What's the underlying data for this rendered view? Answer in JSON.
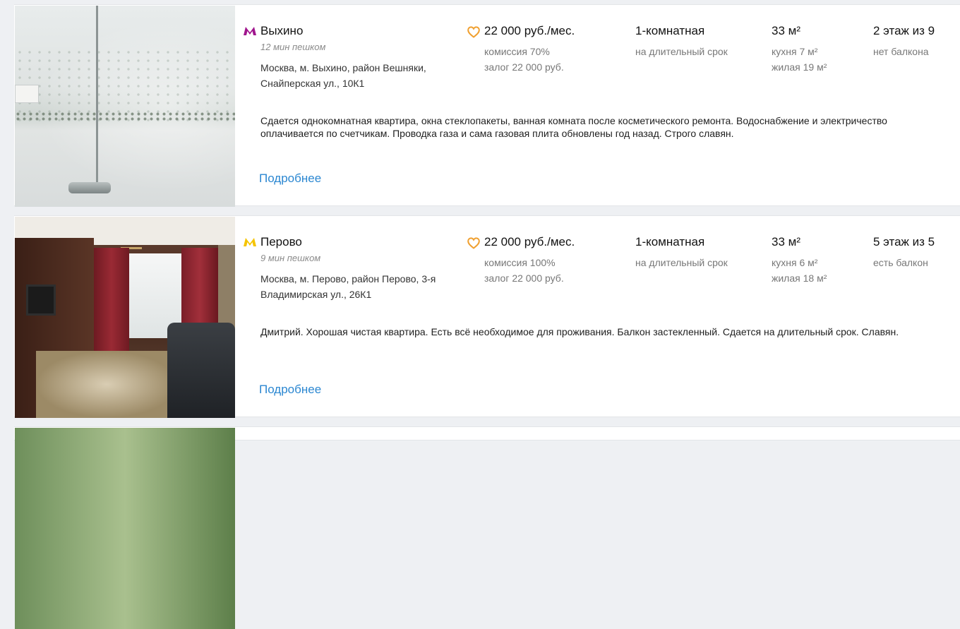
{
  "listings": [
    {
      "metro_color": "#a0158d",
      "station": "Выхино",
      "walk": "12 мин пешком",
      "address": "Москва, м. Выхино, район Вешняки, Снайперская ул., 10К1",
      "price": "22 000 руб./мес.",
      "commission": "комиссия 70%",
      "deposit": "залог 22 000 руб.",
      "rooms": "1-комнатная",
      "term": "на длительный срок",
      "area": "33 м²",
      "kitchen": "кухня 7 м²",
      "living": "жилая 19 м²",
      "floor": "2 этаж из 9",
      "balcony": "нет балкона",
      "description": "Сдается однокомнатная квартира, окна стеклопакеты, ванная комната после косметического ремонта. Водоснабжение и электричество оплачивается по счетчикам. Проводка газа и сама газовая плита обновлены год назад. Строго славян.",
      "more_label": "Подробнее"
    },
    {
      "metro_color": "#f5c400",
      "station": "Перово",
      "walk": "9 мин пешком",
      "address": "Москва, м. Перово, район Перово, 3-я Владимирская ул., 26К1",
      "price": "22 000 руб./мес.",
      "commission": "комиссия 100%",
      "deposit": "залог 22 000 руб.",
      "rooms": "1-комнатная",
      "term": "на длительный срок",
      "area": "33 м²",
      "kitchen": "кухня 6 м²",
      "living": "жилая 18 м²",
      "floor": "5 этаж из 5",
      "balcony": "есть балкон",
      "description": "Дмитрий. Хорошая чистая квартира. Есть всё необходимое для проживания. Балкон застекленный. Сдается на длительный срок. Славян.",
      "more_label": "Подробнее"
    }
  ],
  "accent_color": "#f0a030",
  "link_color": "#2b87d1",
  "icons": {
    "metro": "metro-m-icon",
    "favorite": "heart-icon"
  }
}
